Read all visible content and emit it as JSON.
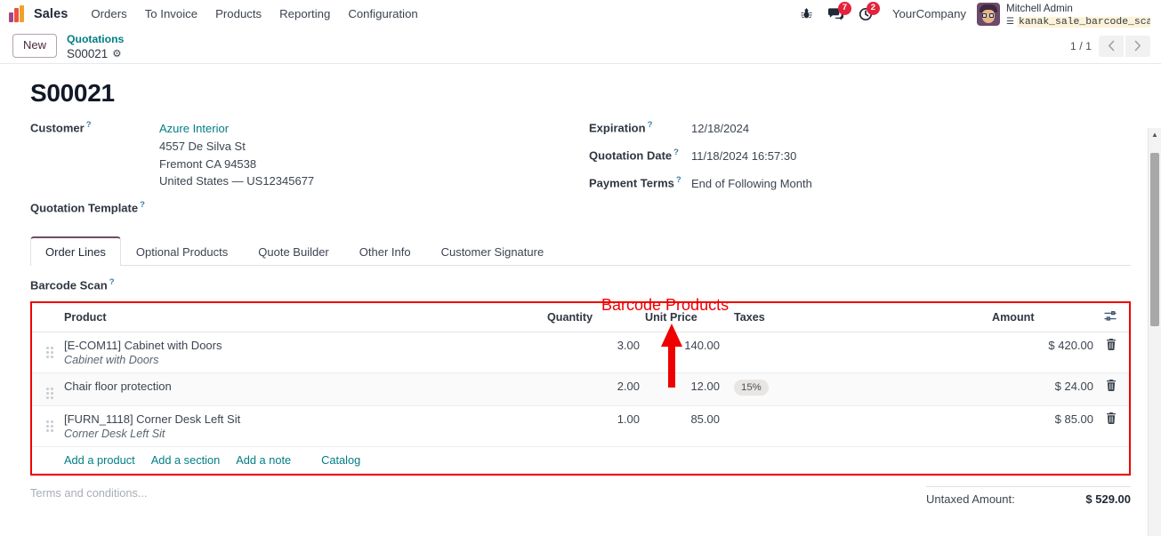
{
  "navbar": {
    "app_name": "Sales",
    "menu_items": [
      "Orders",
      "To Invoice",
      "Products",
      "Reporting",
      "Configuration"
    ],
    "bug_icon": "bug-icon",
    "messages_icon": "messages-icon",
    "messages_count": "7",
    "activities_icon": "activities-clock-icon",
    "activities_count": "2",
    "company": "YourCompany",
    "user_name": "Mitchell Admin",
    "database_name": "kanak_sale_barcode_scan-…",
    "database_icon": "database-icon"
  },
  "control_panel": {
    "new_button": "New",
    "breadcrumb_parent": "Quotations",
    "breadcrumb_current": "S00021",
    "gear_icon": "gear-icon",
    "pager_text": "1 / 1",
    "prev_icon": "chevron-left-icon",
    "next_icon": "chevron-right-icon"
  },
  "record": {
    "title": "S00021",
    "left_fields": [
      {
        "label": "Customer",
        "has_help": true,
        "value_lines": [
          "Azure Interior",
          "4557 De Silva St",
          "Fremont CA 94538",
          "United States — US12345677"
        ]
      },
      {
        "label": "Quotation Template",
        "has_help": true,
        "value_lines": [
          ""
        ]
      }
    ],
    "right_fields": [
      {
        "label": "Expiration",
        "has_help": true,
        "value": "12/18/2024"
      },
      {
        "label": "Quotation Date",
        "has_help": true,
        "value": "11/18/2024 16:57:30"
      },
      {
        "label": "Payment Terms",
        "has_help": true,
        "value": "End of Following Month"
      }
    ]
  },
  "notebook": {
    "tabs": [
      {
        "label": "Order Lines",
        "active": true
      },
      {
        "label": "Optional Products",
        "active": false
      },
      {
        "label": "Quote Builder",
        "active": false
      },
      {
        "label": "Other Info",
        "active": false
      },
      {
        "label": "Customer Signature",
        "active": false
      }
    ],
    "barcode_scan_label": "Barcode Scan",
    "barcode_scan_value": ""
  },
  "lines_table": {
    "headers": {
      "product": "Product",
      "quantity": "Quantity",
      "unit_price": "Unit Price",
      "taxes": "Taxes",
      "amount": "Amount",
      "optional_columns_icon": "optional-columns-icon"
    },
    "rows": [
      {
        "handle_icon": "drag-handle-icon",
        "product": "[E-COM11] Cabinet with Doors",
        "description": "Cabinet with Doors",
        "quantity": "3.00",
        "unit_price": "140.00",
        "taxes": "",
        "amount": "$ 420.00",
        "delete_icon": "trash-icon"
      },
      {
        "handle_icon": "drag-handle-icon",
        "product": "Chair floor protection",
        "description": "",
        "quantity": "2.00",
        "unit_price": "12.00",
        "taxes": "15%",
        "amount": "$ 24.00",
        "delete_icon": "trash-icon"
      },
      {
        "handle_icon": "drag-handle-icon",
        "product": "[FURN_1118] Corner Desk Left Sit",
        "description": "Corner Desk Left Sit",
        "quantity": "1.00",
        "unit_price": "85.00",
        "taxes": "",
        "amount": "$ 85.00",
        "delete_icon": "trash-icon"
      }
    ],
    "add_links": [
      "Add a product",
      "Add a section",
      "Add a note"
    ],
    "catalog_link": "Catalog"
  },
  "footer": {
    "terms_placeholder": "Terms and conditions...",
    "untaxed_label": "Untaxed Amount:",
    "untaxed_value": "$ 529.00"
  },
  "annotation": {
    "text": "Barcode Products",
    "color": "#ef0000",
    "arrow_icon": "up-arrow-annotation"
  },
  "colors": {
    "accent_teal": "#017e84",
    "brand_purple": "#714b67",
    "badge_red": "#e4233b",
    "annotation_red": "#ef0000",
    "highlight_yellow": "#fdf3d8"
  },
  "scrollbar": {
    "up_arrow_icon": "scroll-up-arrow-icon",
    "thumb": "scrollbar-thumb"
  }
}
